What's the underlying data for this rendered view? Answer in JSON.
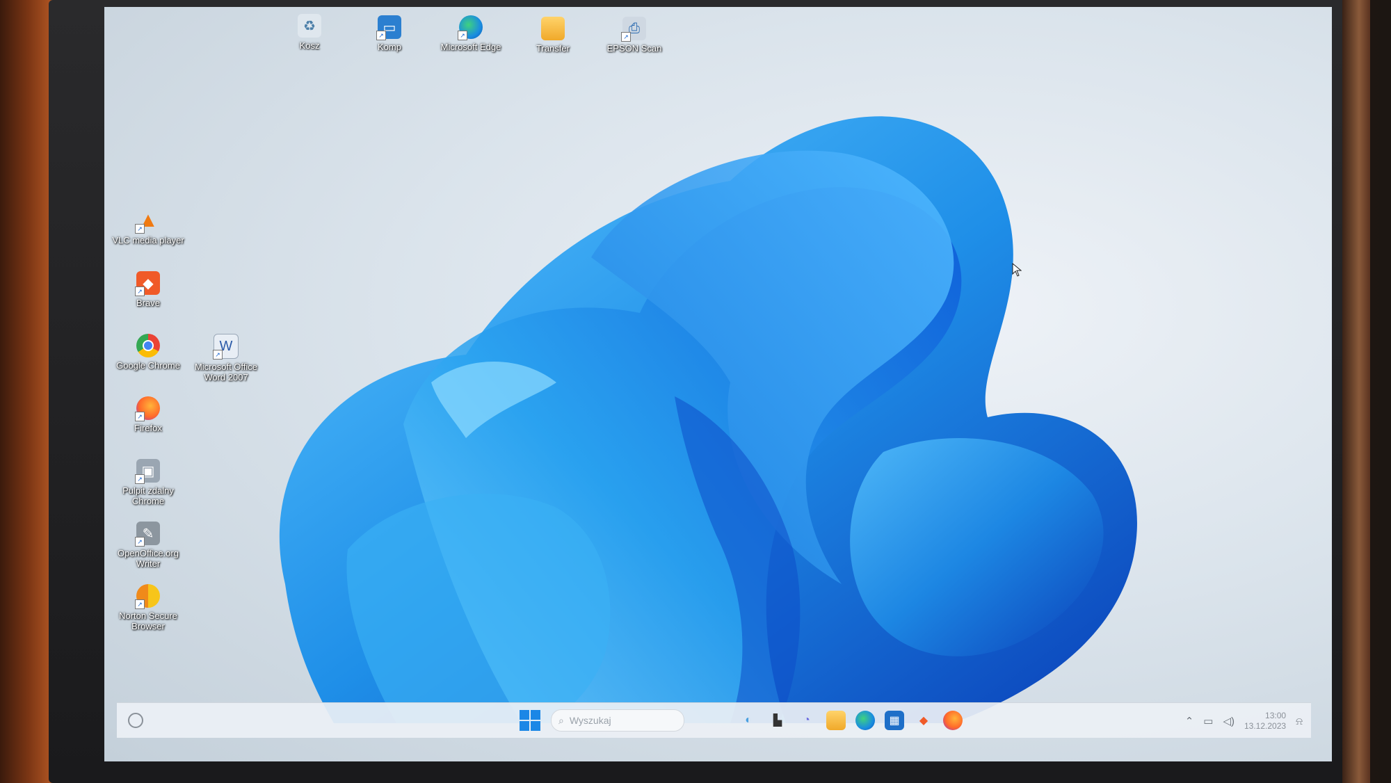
{
  "desktop": {
    "top_icons": [
      {
        "label": "Kosz",
        "icon": "recycle-bin-icon"
      },
      {
        "label": "Komp",
        "icon": "computer-icon"
      },
      {
        "label": "Microsoft Edge",
        "icon": "edge-icon"
      },
      {
        "label": "Transfer",
        "icon": "folder-icon"
      },
      {
        "label": "EPSON Scan",
        "icon": "scanner-icon"
      }
    ],
    "left_icons": [
      {
        "label": "VLC media player",
        "icon": "vlc-icon"
      },
      {
        "label": "Brave",
        "icon": "brave-icon"
      },
      {
        "label": "Google Chrome",
        "icon": "chrome-icon"
      },
      {
        "label": "Firefox",
        "icon": "firefox-icon"
      },
      {
        "label": "Pulpit zdalny Chrome",
        "icon": "remote-desktop-icon"
      },
      {
        "label": "OpenOffice.org Writer",
        "icon": "openoffice-writer-icon"
      },
      {
        "label": "Norton Secure Browser",
        "icon": "norton-browser-icon"
      }
    ],
    "second_column_icons": [
      {
        "label": "Microsoft Office Word 2007",
        "icon": "word-icon"
      }
    ]
  },
  "taskbar": {
    "search_placeholder": "Wyszukaj",
    "apps": [
      "copilot-icon",
      "task-view-icon",
      "chat-icon",
      "file-explorer-icon",
      "edge-icon",
      "store-icon",
      "brave-icon",
      "firefox-icon"
    ],
    "clock": {
      "time": "13:00",
      "date": "13.12.2023"
    }
  },
  "colors": {
    "accent": "#1b87e6",
    "bloom_blue": "#1f8fe8",
    "taskbar_bg": "#eef1f5"
  }
}
